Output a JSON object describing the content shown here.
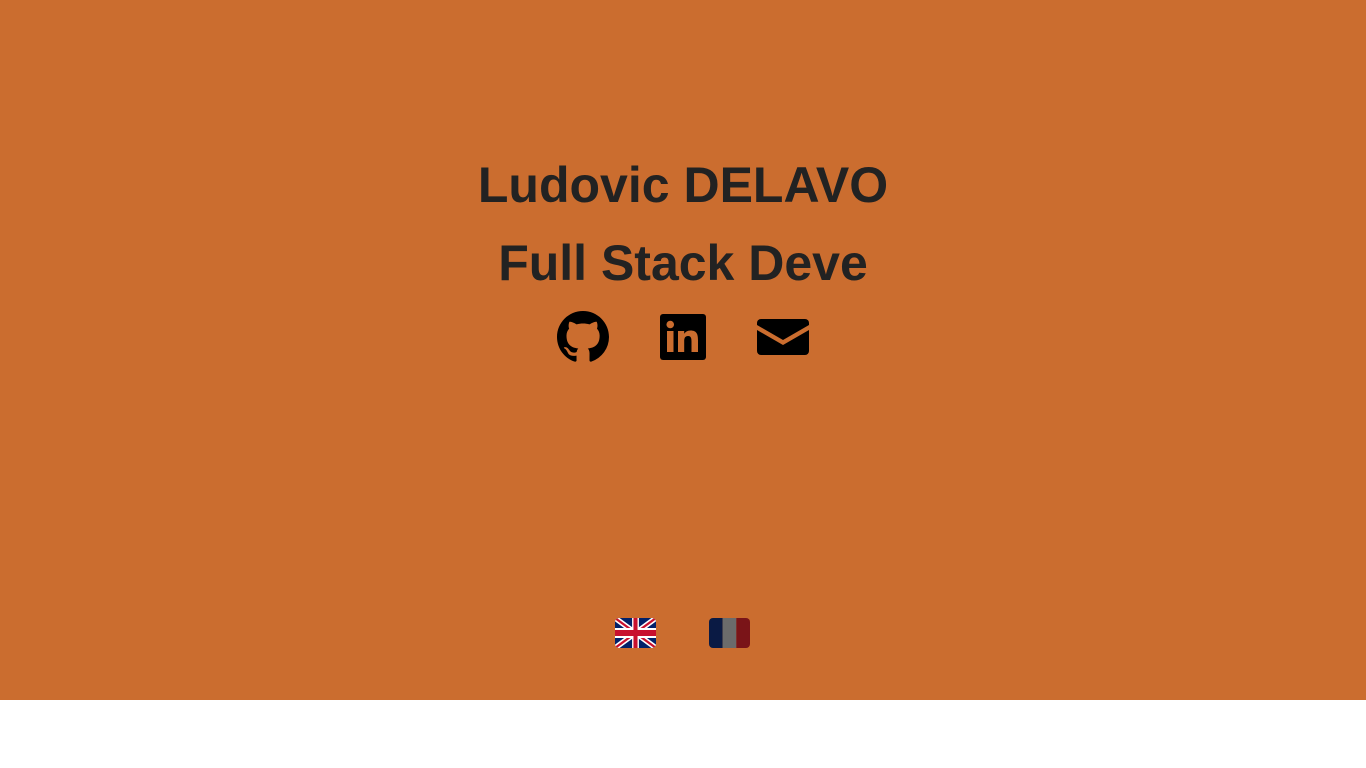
{
  "header": {
    "name": "Ludovic DELAVO",
    "role": "Full Stack Deve"
  },
  "social": [
    {
      "icon": "github-icon",
      "label": "GitHub"
    },
    {
      "icon": "linkedin-icon",
      "label": "LinkedIn"
    },
    {
      "icon": "envelope-icon",
      "label": "Email"
    }
  ],
  "languages": [
    {
      "icon": "uk-flag-icon",
      "code": "en"
    },
    {
      "icon": "france-flag-icon",
      "code": "fr"
    }
  ],
  "colors": {
    "hero_background": "#cb6d2f",
    "text": "#222222",
    "icons": "#000000",
    "footer_background": "#ffffff"
  }
}
